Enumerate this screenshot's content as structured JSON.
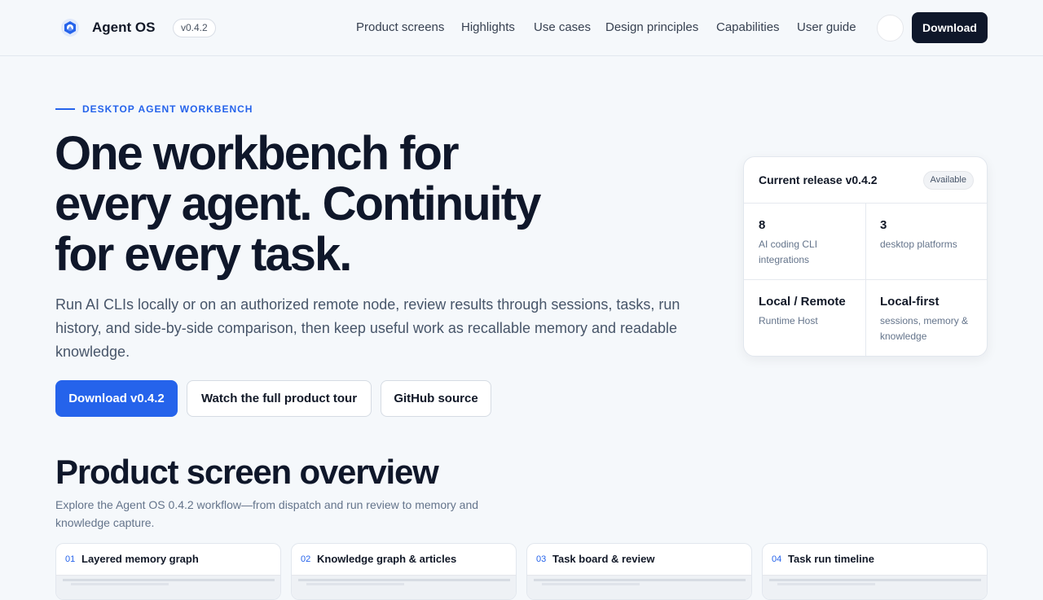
{
  "header": {
    "brand": "Agent OS",
    "version": "v0.4.2",
    "nav": [
      "Product screens",
      "Highlights",
      "Use cases",
      "Design principles",
      "Capabilities",
      "User guide"
    ],
    "download_label": "Download"
  },
  "hero": {
    "eyebrow": "DESKTOP AGENT WORKBENCH",
    "title_lines": [
      "One workbench for",
      "every agent. Continuity",
      "for every task."
    ],
    "description": "Run AI CLIs locally or on an authorized remote node, review results through sessions, tasks, run history, and side-by-side comparison, then keep useful work as recallable memory and readable knowledge.",
    "buttons": {
      "primary": "Download v0.4.2",
      "tour": "Watch the full product tour",
      "github": "GitHub source"
    }
  },
  "release_card": {
    "title": "Current release v0.4.2",
    "badge": "Available",
    "stats": [
      {
        "value": "8",
        "label": "AI coding CLI integrations"
      },
      {
        "value": "3",
        "label": "desktop platforms"
      },
      {
        "value": "Local / Remote",
        "label": "Runtime Host"
      },
      {
        "value": "Local-first",
        "label": "sessions, memory & knowledge"
      }
    ]
  },
  "overview": {
    "title": "Product screen overview",
    "description": "Explore the Agent OS 0.4.2 workflow—from dispatch and run review to memory and knowledge capture.",
    "tiles": [
      {
        "num": "01",
        "label": "Layered memory graph"
      },
      {
        "num": "02",
        "label": "Knowledge graph & articles"
      },
      {
        "num": "03",
        "label": "Task board & review"
      },
      {
        "num": "04",
        "label": "Task run timeline"
      }
    ]
  },
  "colors": {
    "accent": "#2563eb",
    "dark": "#0f172a",
    "background": "#f5f8fb"
  }
}
